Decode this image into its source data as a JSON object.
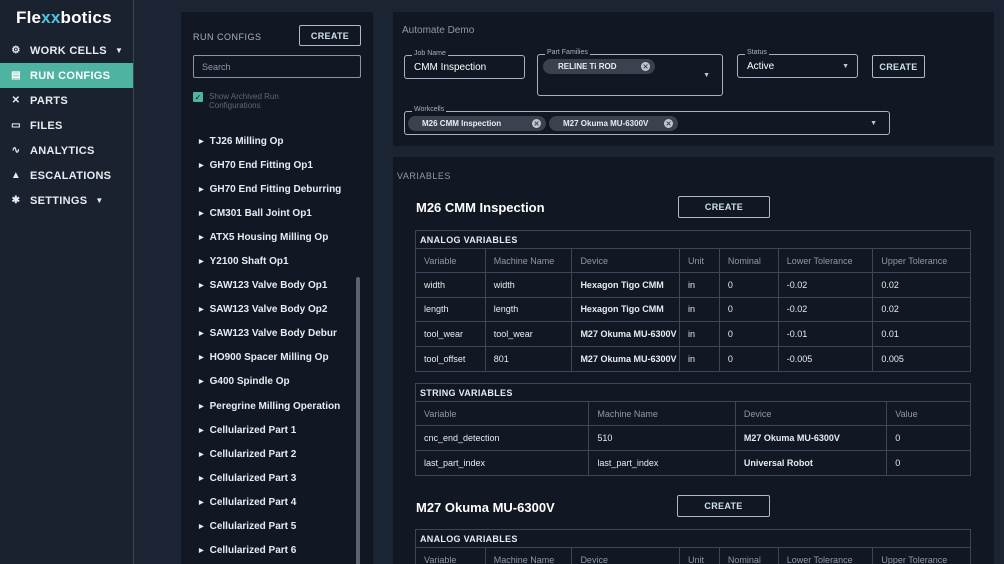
{
  "brand": {
    "name_prefix": "Fle",
    "name_x": "xx",
    "name_suffix": "botics"
  },
  "nav": [
    {
      "label": "WORK CELLS",
      "icon": "robot-arm-icon",
      "glyph": "⚙",
      "caret": "▼"
    },
    {
      "label": "RUN CONFIGS",
      "icon": "document-icon",
      "glyph": "▤",
      "active": true
    },
    {
      "label": "PARTS",
      "icon": "tools-icon",
      "glyph": "✕"
    },
    {
      "label": "FILES",
      "icon": "folder-icon",
      "glyph": "▭"
    },
    {
      "label": "ANALYTICS",
      "icon": "trend-icon",
      "glyph": "∿"
    },
    {
      "label": "ESCALATIONS",
      "icon": "warning-icon",
      "glyph": "▲"
    },
    {
      "label": "SETTINGS",
      "icon": "gear-icon",
      "glyph": "✱",
      "caret": "▼"
    }
  ],
  "run_configs": {
    "title": "RUN CONFIGS",
    "create_label": "CREATE",
    "search_placeholder": "Search",
    "checkbox_label": "Show Archived Run Configurations",
    "items": [
      "TJ26 Milling Op",
      "GH70 End Fitting Op1",
      "GH70 End Fitting Deburring",
      "CM301 Ball Joint Op1",
      "ATX5 Housing Milling Op",
      "Y2100 Shaft Op1",
      "SAW123 Valve Body Op1",
      "SAW123 Valve Body Op2",
      "SAW123 Valve Body Debur",
      "HO900 Spacer Milling Op",
      "G400 Spindle Op",
      "Peregrine Milling Operation",
      "Cellularized Part 1",
      "Cellularized Part 2",
      "Cellularized Part 3",
      "Cellularized Part 4",
      "Cellularized Part 5",
      "Cellularized Part 6"
    ]
  },
  "automate": {
    "title": "Automate Demo",
    "job_name_label": "Job Name",
    "job_name_value": "CMM Inspection",
    "part_families_label": "Part Families",
    "part_family_chip": "RELINE Ti ROD",
    "status_label": "Status",
    "status_value": "Active",
    "create_label": "CREATE",
    "workcells_label": "Workcells",
    "workcell_chips": [
      "M26 CMM Inspection",
      "M27 Okuma MU-6300V"
    ]
  },
  "variables": {
    "title": "VARIABLES",
    "sections": [
      {
        "name": "M26 CMM Inspection",
        "create_label": "CREATE",
        "analog_title": "ANALOG VARIABLES",
        "analog_headers": [
          "Variable",
          "Machine Name",
          "Device",
          "Unit",
          "Nominal",
          "Lower Tolerance",
          "Upper Tolerance"
        ],
        "analog_rows": [
          [
            "width",
            "width",
            "Hexagon Tigo CMM",
            "in",
            "0",
            "-0.02",
            "0.02"
          ],
          [
            "length",
            "length",
            "Hexagon Tigo CMM",
            "in",
            "0",
            "-0.02",
            "0.02"
          ],
          [
            "tool_wear",
            "tool_wear",
            "M27 Okuma MU-6300V",
            "in",
            "0",
            "-0.01",
            "0.01"
          ],
          [
            "tool_offset",
            "801",
            "M27 Okuma MU-6300V",
            "in",
            "0",
            "-0.005",
            "0.005"
          ]
        ],
        "string_title": "STRING VARIABLES",
        "string_headers": [
          "Variable",
          "Machine Name",
          "Device",
          "Value"
        ],
        "string_rows": [
          [
            "cnc_end_detection",
            "510",
            "M27 Okuma MU-6300V",
            "0"
          ],
          [
            "last_part_index",
            "last_part_index",
            "Universal Robot",
            "0"
          ]
        ]
      },
      {
        "name": "M27 Okuma MU-6300V",
        "create_label": "CREATE",
        "analog_title": "ANALOG VARIABLES",
        "analog_headers": [
          "Variable",
          "Machine Name",
          "Device",
          "Unit",
          "Nominal",
          "Lower Tolerance",
          "Upper Tolerance"
        ]
      }
    ]
  }
}
